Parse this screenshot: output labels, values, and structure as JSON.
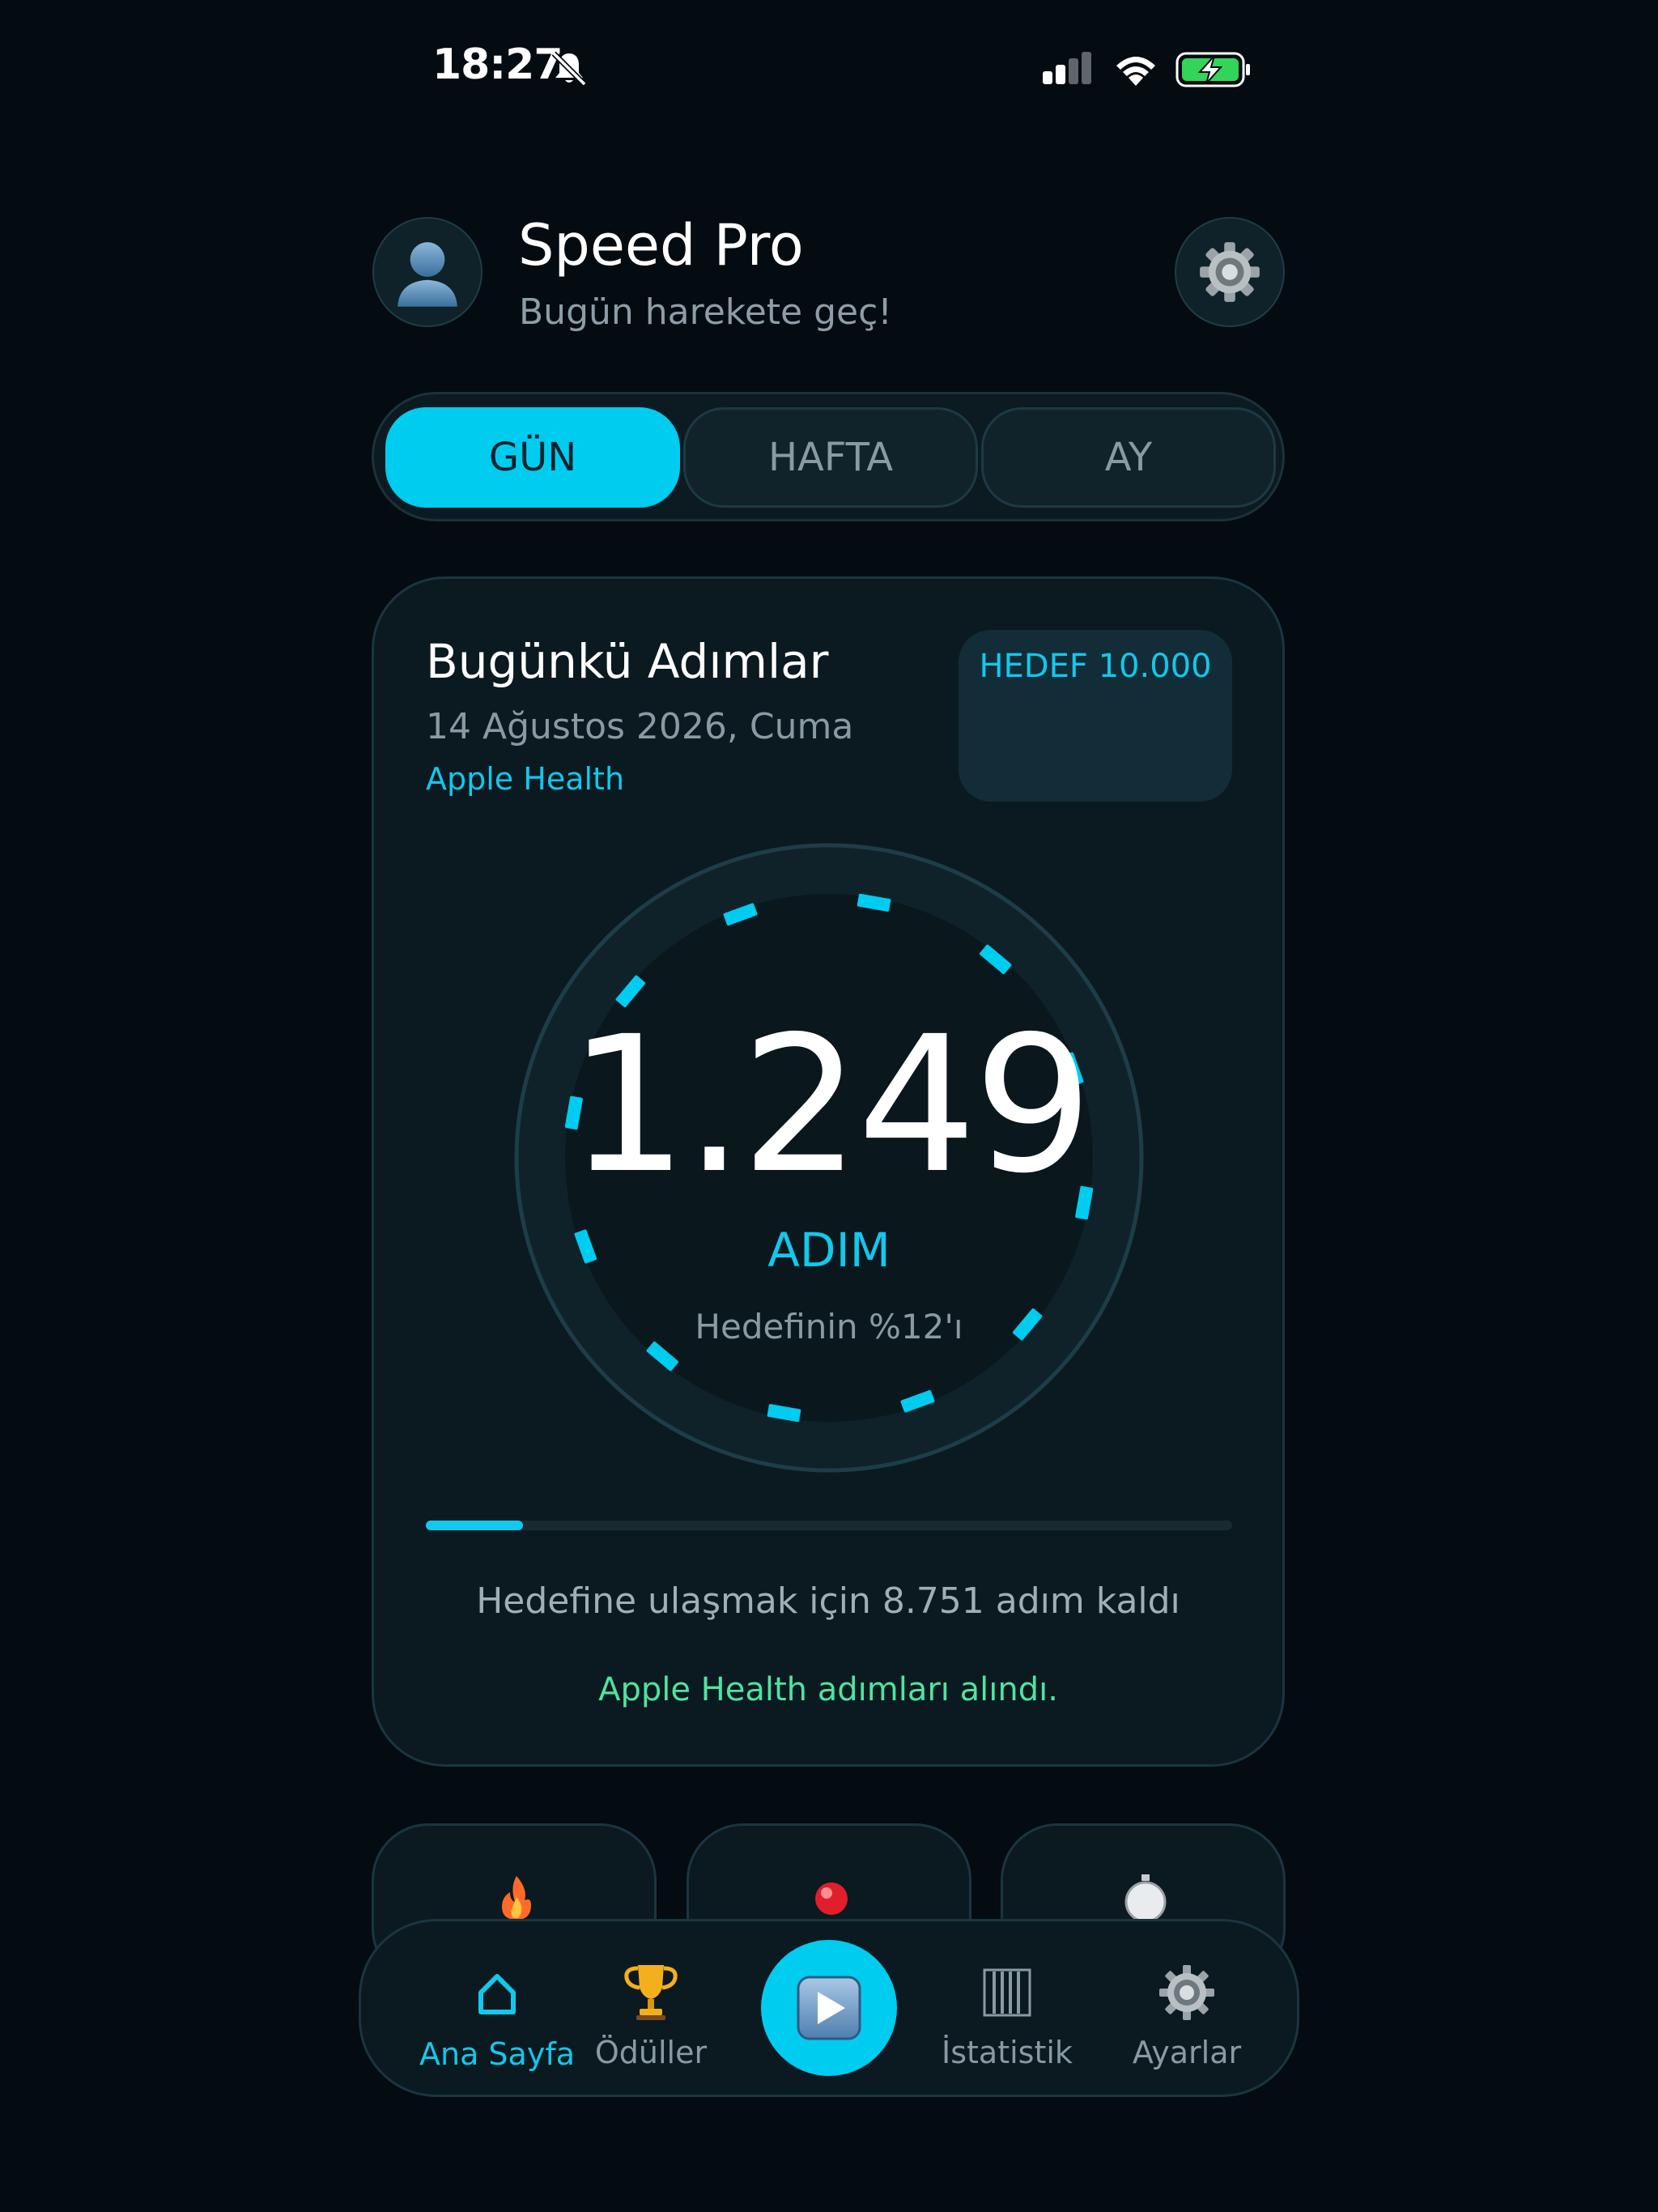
{
  "status_bar": {
    "time": "18:27",
    "icons": [
      "bell-slash-icon",
      "cellular-signal-icon",
      "wifi-icon",
      "battery-charging-icon"
    ]
  },
  "header": {
    "title": "Speed Pro",
    "subtitle": "Bugün harekete geç!",
    "avatar_icon": "user-avatar-icon",
    "settings_icon": "gear-icon"
  },
  "period_tabs": {
    "selected": "GÜN",
    "items": [
      {
        "label": "GÜN"
      },
      {
        "label": "HAFTA"
      },
      {
        "label": "AY"
      }
    ]
  },
  "steps_card": {
    "title": "Bugünkü Adımlar",
    "date": "14 Ağustos 2026, Cuma",
    "source": "Apple Health",
    "goal_label": "HEDEF 10.000",
    "steps_value": "1.249",
    "steps_unit": "ADIM",
    "percent_text": "Hedefinin %12'ı",
    "progress_fraction": 0.12,
    "remaining_text": "Hedefine ulaşmak için 8.751 adım kaldı",
    "sync_status": "Apple Health adımları alındı."
  },
  "mini_cards": [
    {
      "icon": "flame-icon"
    },
    {
      "icon": "red-dot-icon"
    },
    {
      "icon": "stopwatch-icon"
    }
  ],
  "tab_bar": {
    "items": [
      {
        "label": "Ana Sayfa",
        "icon": "home-icon",
        "active": true
      },
      {
        "label": "Ödüller",
        "icon": "trophy-icon"
      },
      {
        "label": "",
        "icon": "play-icon"
      },
      {
        "label": "İstatistik",
        "icon": "bar-chart-icon"
      },
      {
        "label": "Ayarlar",
        "icon": "gear-icon"
      }
    ]
  },
  "colors": {
    "background": "#040b11",
    "accent": "#00ccf0",
    "card": "#0b1a20",
    "success": "#4fe3a0",
    "muted_text": "#8a9aa3"
  }
}
